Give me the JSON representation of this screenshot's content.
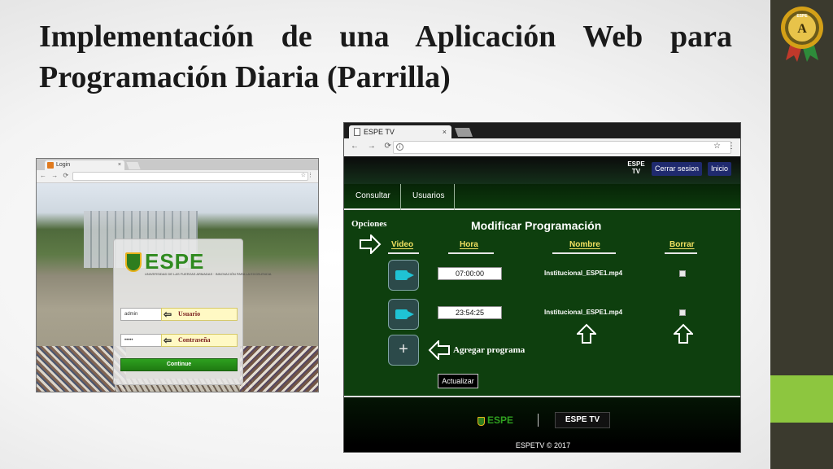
{
  "slide": {
    "title": "Implementación de una Aplicación Web para Programación Diaria (Parrilla)",
    "seal_text": "ESPE",
    "seal_letter": "A",
    "colors": {
      "right_bar": "#3b3a2e",
      "right_accent": "#8dc63f"
    }
  },
  "login_screenshot": {
    "tab_title": "Login",
    "tab_close": "×",
    "logo_text": "ESPE",
    "logo_subtitle": "UNIVERSIDAD DE LAS FUERZAS ARMADAS · INNOVACIÓN PARA LA EXCELENCIA",
    "username_value": "admin",
    "username_callout": "Usuario",
    "password_value": "•••••",
    "password_callout": "Contraseña",
    "continue_label": "Continue",
    "colors": {
      "continue": "#2ea01f",
      "callout_bg": "#fff9c4"
    }
  },
  "app_screenshot": {
    "tab_title": "ESPE TV",
    "tab_close": "×",
    "header_logo": "ESPE TV",
    "logout_label": "Cerrar sesion",
    "home_label": "Inicio",
    "nav": [
      "Consultar",
      "Usuarios"
    ],
    "options_label": "Opciones",
    "page_title": "Modificar Programación",
    "columns": [
      "Video",
      "Hora",
      "Nombre",
      "Borrar"
    ],
    "rows": [
      {
        "time": "07:00:00",
        "name": "Institucional_ESPE1.mp4"
      },
      {
        "time": "23:54:25",
        "name": "Institucional_ESPE1.mp4"
      }
    ],
    "add_symbol": "+",
    "add_label": "Agregar programa",
    "update_label": "Actualizar",
    "footer_logo_1": "ESPE",
    "footer_logo_2": "ESPE TV",
    "footer_copyright": "ESPETV © 2017",
    "colors": {
      "background": "#0e3f0e",
      "column_header": "#f0e060",
      "header_button": "#1f2a6e"
    }
  }
}
